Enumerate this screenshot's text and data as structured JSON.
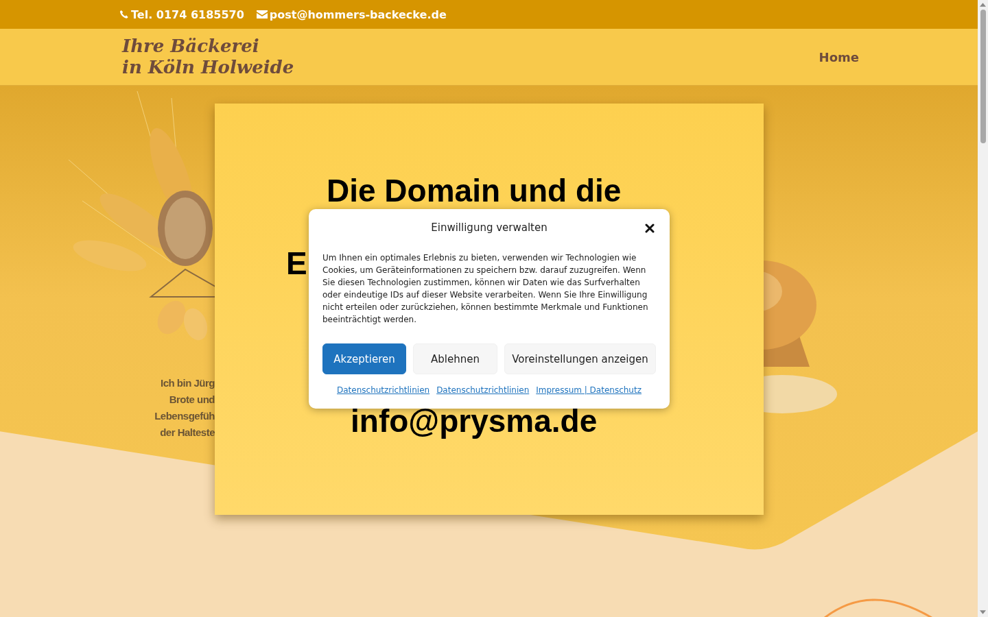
{
  "top_bar": {
    "phone": "Tel. 0174 6185570",
    "email": "post@hommers-backecke.de"
  },
  "header": {
    "logo_lines": [
      "Ihre Bäckerei",
      "in Köln Holweide"
    ],
    "nav": [
      "Home"
    ]
  },
  "hero": {
    "intro_lines": [
      "Ich bin Jürg",
      "Brote und",
      "Lebensgefüh",
      "der Halteste"
    ]
  },
  "domain_popup": {
    "heading": "Die Domain und die",
    "heading_fragment": "E",
    "email": "info@prysma.de"
  },
  "consent": {
    "title": "Einwilligung verwalten",
    "body": "Um Ihnen ein optimales Erlebnis zu bieten, verwenden wir Technologien wie Cookies, um Geräteinformationen zu speichern bzw. darauf zuzugreifen. Wenn Sie diesen Technologien zustimmen, können wir Daten wie das Surfverhalten oder eindeutige IDs auf dieser Website verarbeiten. Wenn Sie Ihre Einwilligung nicht erteilen oder zurückziehen, können bestimmte Merkmale und Funktionen beeinträchtigt werden.",
    "buttons": [
      {
        "label": "Akzeptieren",
        "kind": "primary"
      },
      {
        "label": "Ablehnen",
        "kind": "secondary"
      },
      {
        "label": "Voreinstellungen anzeigen",
        "kind": "secondary"
      }
    ],
    "links": [
      "Datenschutzrichtlinien",
      "Datenschutzrichtlinien",
      "Impressum | Datenschutz"
    ]
  }
}
